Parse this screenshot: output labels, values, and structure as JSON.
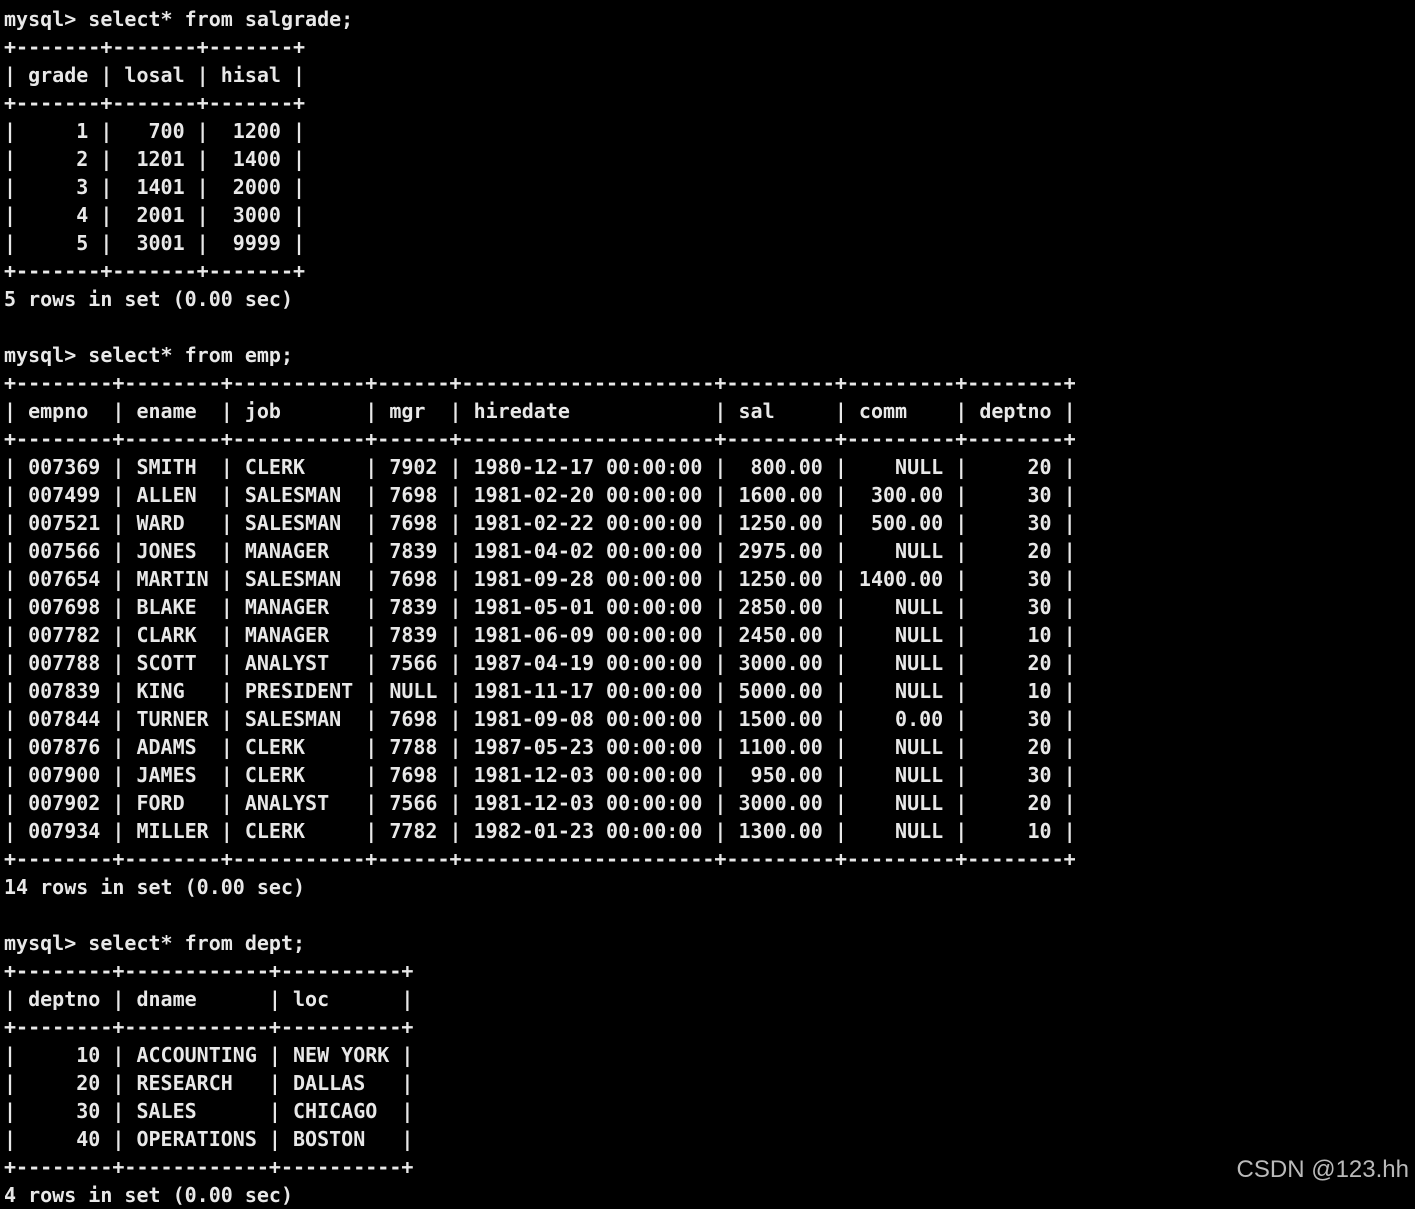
{
  "terminal": {
    "lines": [
      "mysql> select* from salgrade;",
      "+-------+-------+-------+",
      "| grade | losal | hisal |",
      "+-------+-------+-------+",
      "|     1 |   700 |  1200 |",
      "|     2 |  1201 |  1400 |",
      "|     3 |  1401 |  2000 |",
      "|     4 |  2001 |  3000 |",
      "|     5 |  3001 |  9999 |",
      "+-------+-------+-------+",
      "5 rows in set (0.00 sec)",
      "",
      "mysql> select* from emp;",
      "+--------+--------+-----------+------+---------------------+---------+---------+--------+",
      "| empno  | ename  | job       | mgr  | hiredate            | sal     | comm    | deptno |",
      "+--------+--------+-----------+------+---------------------+---------+---------+--------+",
      "| 007369 | SMITH  | CLERK     | 7902 | 1980-12-17 00:00:00 |  800.00 |    NULL |     20 |",
      "| 007499 | ALLEN  | SALESMAN  | 7698 | 1981-02-20 00:00:00 | 1600.00 |  300.00 |     30 |",
      "| 007521 | WARD   | SALESMAN  | 7698 | 1981-02-22 00:00:00 | 1250.00 |  500.00 |     30 |",
      "| 007566 | JONES  | MANAGER   | 7839 | 1981-04-02 00:00:00 | 2975.00 |    NULL |     20 |",
      "| 007654 | MARTIN | SALESMAN  | 7698 | 1981-09-28 00:00:00 | 1250.00 | 1400.00 |     30 |",
      "| 007698 | BLAKE  | MANAGER   | 7839 | 1981-05-01 00:00:00 | 2850.00 |    NULL |     30 |",
      "| 007782 | CLARK  | MANAGER   | 7839 | 1981-06-09 00:00:00 | 2450.00 |    NULL |     10 |",
      "| 007788 | SCOTT  | ANALYST   | 7566 | 1987-04-19 00:00:00 | 3000.00 |    NULL |     20 |",
      "| 007839 | KING   | PRESIDENT | NULL | 1981-11-17 00:00:00 | 5000.00 |    NULL |     10 |",
      "| 007844 | TURNER | SALESMAN  | 7698 | 1981-09-08 00:00:00 | 1500.00 |    0.00 |     30 |",
      "| 007876 | ADAMS  | CLERK     | 7788 | 1987-05-23 00:00:00 | 1100.00 |    NULL |     20 |",
      "| 007900 | JAMES  | CLERK     | 7698 | 1981-12-03 00:00:00 |  950.00 |    NULL |     30 |",
      "| 007902 | FORD   | ANALYST   | 7566 | 1981-12-03 00:00:00 | 3000.00 |    NULL |     20 |",
      "| 007934 | MILLER | CLERK     | 7782 | 1982-01-23 00:00:00 | 1300.00 |    NULL |     10 |",
      "+--------+--------+-----------+------+---------------------+---------+---------+--------+",
      "14 rows in set (0.00 sec)",
      "",
      "mysql> select* from dept;",
      "+--------+------------+----------+",
      "| deptno | dname      | loc      |",
      "+--------+------------+----------+",
      "|     10 | ACCOUNTING | NEW YORK |",
      "|     20 | RESEARCH   | DALLAS   |",
      "|     30 | SALES      | CHICAGO  |",
      "|     40 | OPERATIONS | BOSTON   |",
      "+--------+------------+----------+",
      "4 rows in set (0.00 sec)"
    ]
  },
  "watermark": "CSDN @123.hh",
  "colors": {
    "background": "#000000",
    "text": "#e8e8e8"
  }
}
